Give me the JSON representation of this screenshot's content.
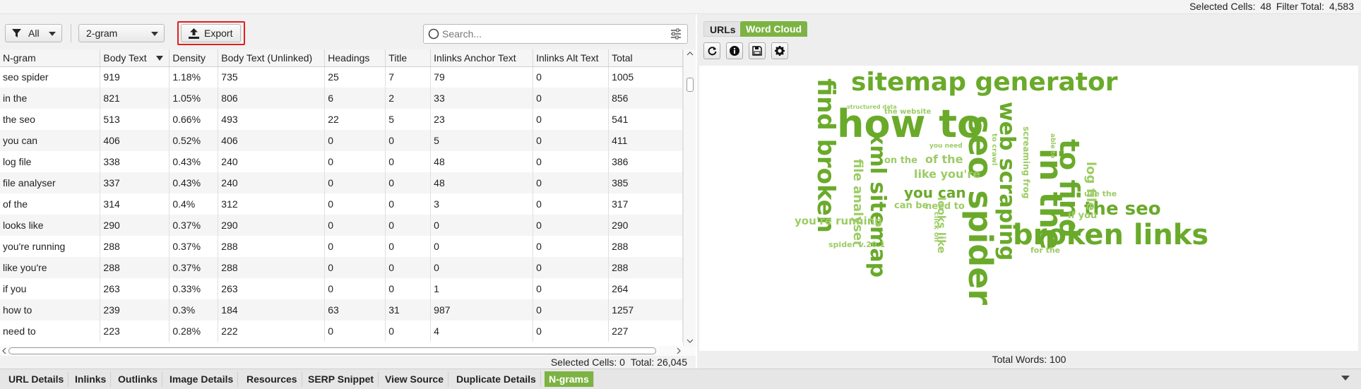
{
  "top_status": {
    "selected_label": "Selected Cells:",
    "selected_value": "48",
    "filter_label": "Filter Total:",
    "filter_value": "4,583"
  },
  "toolbar": {
    "filter_label": "All",
    "ngram_label": "2-gram",
    "export_label": "Export",
    "search_placeholder": "Search..."
  },
  "table": {
    "columns": [
      "N-gram",
      "Body Text",
      "Density",
      "Body Text (Unlinked)",
      "Headings",
      "Title",
      "Inlinks Anchor Text",
      "Inlinks Alt Text",
      "Total"
    ],
    "rows": [
      [
        "seo spider",
        "919",
        "1.18%",
        "735",
        "25",
        "7",
        "79",
        "0",
        "1005"
      ],
      [
        "in the",
        "821",
        "1.05%",
        "806",
        "6",
        "2",
        "33",
        "0",
        "856"
      ],
      [
        "the seo",
        "513",
        "0.66%",
        "493",
        "22",
        "5",
        "23",
        "0",
        "541"
      ],
      [
        "you can",
        "406",
        "0.52%",
        "406",
        "0",
        "0",
        "5",
        "0",
        "411"
      ],
      [
        "log file",
        "338",
        "0.43%",
        "240",
        "0",
        "0",
        "48",
        "0",
        "386"
      ],
      [
        "file analyser",
        "337",
        "0.43%",
        "240",
        "0",
        "0",
        "48",
        "0",
        "385"
      ],
      [
        "of the",
        "314",
        "0.4%",
        "312",
        "0",
        "0",
        "3",
        "0",
        "317"
      ],
      [
        "looks like",
        "290",
        "0.37%",
        "290",
        "0",
        "0",
        "0",
        "0",
        "290"
      ],
      [
        "you're running",
        "288",
        "0.37%",
        "288",
        "0",
        "0",
        "0",
        "0",
        "288"
      ],
      [
        "like you're",
        "288",
        "0.37%",
        "288",
        "0",
        "0",
        "0",
        "0",
        "288"
      ],
      [
        "if you",
        "263",
        "0.33%",
        "263",
        "0",
        "0",
        "1",
        "0",
        "264"
      ],
      [
        "how to",
        "239",
        "0.3%",
        "184",
        "63",
        "31",
        "987",
        "0",
        "1257"
      ],
      [
        "need to",
        "223",
        "0.28%",
        "222",
        "0",
        "0",
        "4",
        "0",
        "227"
      ]
    ]
  },
  "left_status": {
    "selected_label": "Selected Cells:",
    "selected_value": "0",
    "total_label": "Total:",
    "total_value": "26,045"
  },
  "right_panel": {
    "tabs": [
      {
        "label": "URLs"
      },
      {
        "label": "Word Cloud"
      }
    ],
    "icons": [
      "refresh-icon",
      "info-icon",
      "save-icon",
      "settings-icon"
    ],
    "total_words_label": "Total Words:",
    "total_words_value": "100"
  },
  "word_cloud": [
    {
      "text": "how to"
    },
    {
      "text": "sitemap generator"
    },
    {
      "text": "find broken"
    },
    {
      "text": "seo spider"
    },
    {
      "text": "xml sitemap"
    },
    {
      "text": "web scraping"
    },
    {
      "text": "in the"
    },
    {
      "text": "to find"
    },
    {
      "text": "broken links"
    },
    {
      "text": "the seo"
    },
    {
      "text": "log file"
    },
    {
      "text": "file analyser"
    },
    {
      "text": "you can"
    },
    {
      "text": "like you're"
    },
    {
      "text": "of the"
    },
    {
      "text": "you're running"
    },
    {
      "text": "looks like"
    },
    {
      "text": "need to"
    },
    {
      "text": "on the"
    },
    {
      "text": "can be"
    },
    {
      "text": "if you"
    },
    {
      "text": "use the"
    },
    {
      "text": "screaming frog"
    },
    {
      "text": "spider v.20.1"
    },
    {
      "text": "for the"
    },
    {
      "text": "the website"
    },
    {
      "text": "structured data"
    },
    {
      "text": "able to"
    },
    {
      "text": "you need"
    },
    {
      "text": "click on"
    },
    {
      "text": "to crawl"
    }
  ],
  "bottom_tabs": [
    {
      "label": "URL Details"
    },
    {
      "label": "Inlinks"
    },
    {
      "label": "Outlinks"
    },
    {
      "label": "Image Details"
    },
    {
      "label": "Resources"
    },
    {
      "label": "SERP Snippet"
    },
    {
      "label": "View Source"
    },
    {
      "label": "Duplicate Details"
    },
    {
      "label": "N-grams"
    }
  ],
  "colors": {
    "accent_green": "#7cb342",
    "cloud_green_dark": "#6aaa2a",
    "cloud_green_light": "#9ccc65",
    "highlight_red": "#e0201f"
  }
}
